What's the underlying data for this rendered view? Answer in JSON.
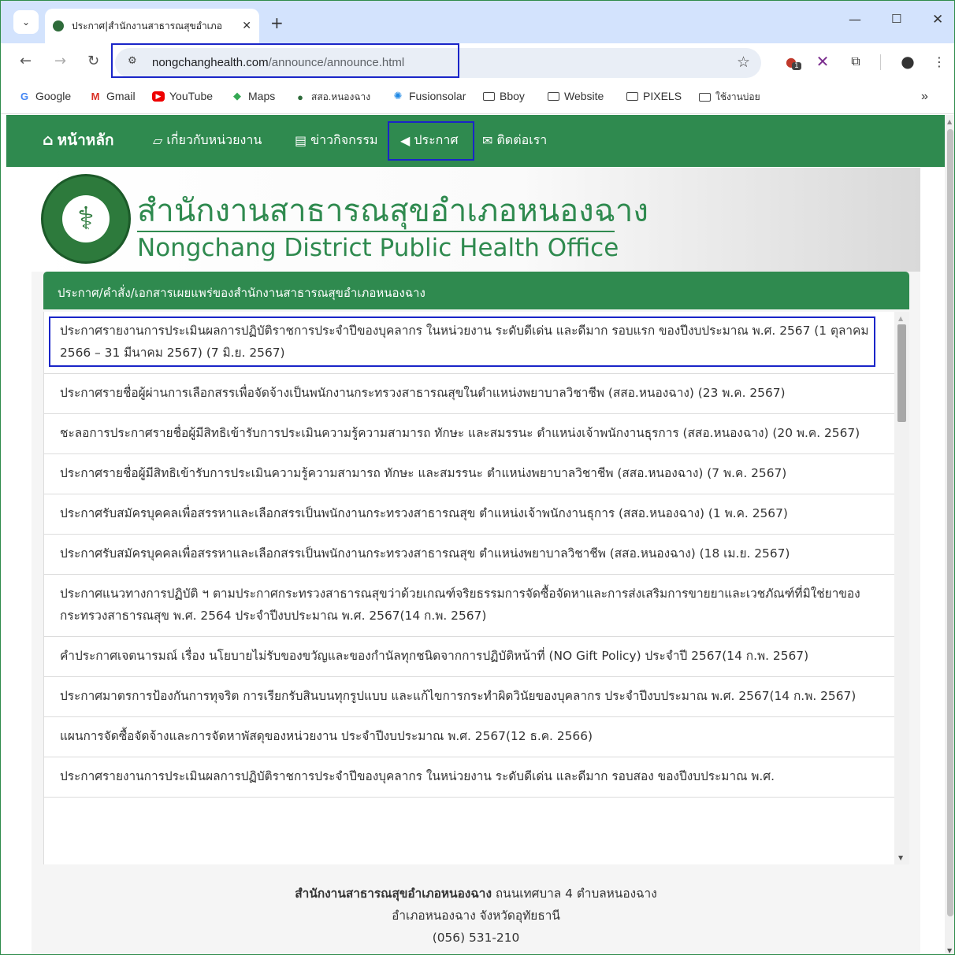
{
  "browser": {
    "tab_title": "ประกาศ|สำนักงานสาธารณสุขอำเภอ",
    "new_tab": "+",
    "url_host": "nongchanghealth.com",
    "url_path": "/announce/announce.html",
    "extension_badge": "1",
    "more_bookmarks": "»",
    "bookmarks": [
      {
        "label": "Google",
        "icon": "google-icon"
      },
      {
        "label": "Gmail",
        "icon": "gmail-icon"
      },
      {
        "label": "YouTube",
        "icon": "youtube-icon"
      },
      {
        "label": "Maps",
        "icon": "maps-icon"
      },
      {
        "label": "สสอ.หนองฉาง",
        "icon": "site-icon"
      },
      {
        "label": "Fusionsolar",
        "icon": "fusionsolar-icon"
      },
      {
        "label": "Bboy",
        "icon": "folder-icon"
      },
      {
        "label": "Website",
        "icon": "folder-icon"
      },
      {
        "label": "PIXELS",
        "icon": "folder-icon"
      },
      {
        "label": "ใช้งานบ่อย",
        "icon": "folder-icon"
      }
    ]
  },
  "site_nav": {
    "home": "หน้าหลัก",
    "about": "เกี่ยวกับหน่วยงาน",
    "news": "ข่าวกิจกรรม",
    "announce": "ประกาศ",
    "contact": "ติดต่อเรา"
  },
  "header": {
    "title_th": "สำนักงานสาธารณสุขอำเภอหนองฉาง",
    "title_en": "Nongchang District Public Health Office"
  },
  "panel": {
    "heading": "ประกาศ/คำสั่ง/เอกสารเผยแพร่ของสำนักงานสาธารณสุขอำเภอหนองฉาง",
    "items": [
      "ประกาศรายงานการประเมินผลการปฏิบัติราชการประจำปีของบุคลากร ในหน่วยงาน ระดับดีเด่น และดีมาก รอบแรก ของปีงบประมาณ พ.ศ. 2567 (1 ตุลาคม 2566 – 31 มีนาคม 2567) (7 มิ.ย. 2567)",
      "ประกาศรายชื่อผู้ผ่านการเลือกสรรเพื่อจัดจ้างเป็นพนักงานกระทรวงสาธารณสุขในตำแหน่งพยาบาลวิชาชีพ (สสอ.หนองฉาง) (23 พ.ค. 2567)",
      "ชะลอการประกาศรายชื่อผู้มีสิทธิเข้ารับการประเมินความรู้ความสามารถ ทักษะ และสมรรนะ ตำแหน่งเจ้าพนักงานธุรการ (สสอ.หนองฉาง) (20 พ.ค. 2567)",
      "ประกาศรายชื่อผู้มีสิทธิเข้ารับการประเมินความรู้ความสามารถ ทักษะ และสมรรนะ ตำแหน่งพยาบาลวิชาชีพ (สสอ.หนองฉาง) (7 พ.ค. 2567)",
      "ประกาศรับสมัครบุคคลเพื่อสรรหาและเลือกสรรเป็นพนักงานกระทรวงสาธารณสุข ตำแหน่งเจ้าพนักงานธุการ (สสอ.หนองฉาง) (1 พ.ค. 2567)",
      "ประกาศรับสมัครบุคคลเพื่อสรรหาและเลือกสรรเป็นพนักงานกระทรวงสาธารณสุข ตำแหน่งพยาบาลวิชาชีพ (สสอ.หนองฉาง) (18 เม.ย. 2567)",
      "ประกาศแนวทางการปฏิบัติ ฯ ตามประกาศกระทรวงสาธารณสุขว่าด้วยเกณฑ์จริยธรรมการจัดซื้อจัดหาและการส่งเสริมการขายยาและเวชภัณฑ์ที่มิใช่ยาของกระทรวงสาธารณสุข พ.ศ. 2564 ประจำปีงบประมาณ พ.ศ. 2567(14 ก.พ. 2567)",
      "คำประกาศเจตนารมณ์ เรื่อง นโยบายไม่รับของขวัญและของกำนัลทุกชนิดจากการปฏิบัติหน้าที่ (NO Gift Policy) ประจำปี 2567(14 ก.พ. 2567)",
      "ประกาศมาตรการป้องกันการทุจริต การเรียกรับสินบนทุกรูปแบบ และแก้ไขการกระทำผิดวินัยของบุคลากร ประจำปีงบประมาณ พ.ศ. 2567(14 ก.พ. 2567)",
      "แผนการจัดซื้อจัดจ้างและการจัดหาพัสดุของหน่วยงาน ประจำปีงบประมาณ พ.ศ. 2567(12 ธ.ค. 2566)",
      "ประกาศรายงานการประเมินผลการปฏิบัติราชการประจำปีของบุคลากร ในหน่วยงาน ระดับดีเด่น และดีมาก รอบสอง ของปีงบประมาณ พ.ศ."
    ]
  },
  "footer": {
    "org": "สำนักงานสาธารณสุขอำเภอหนองฉาง",
    "addr1": " ถนนเทศบาล 4 ตำบลหนองฉาง",
    "addr2": "อำเภอหนองฉาง จังหวัดอุทัยธานี",
    "phone": "(056) 531-210"
  },
  "colors": {
    "site_green": "#2f8a4f",
    "annotation_blue": "#1a25c8",
    "tabstrip": "#d3e3fd"
  }
}
